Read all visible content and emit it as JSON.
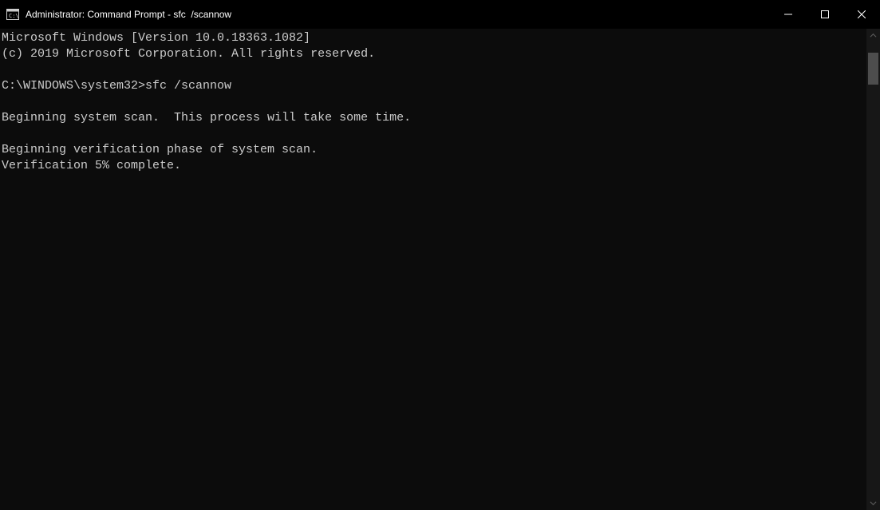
{
  "window": {
    "title": "Administrator: Command Prompt - sfc  /scannow"
  },
  "terminal": {
    "line1": "Microsoft Windows [Version 10.0.18363.1082]",
    "line2": "(c) 2019 Microsoft Corporation. All rights reserved.",
    "blank1": "",
    "prompt": "C:\\WINDOWS\\system32>",
    "command": "sfc /scannow",
    "blank2": "",
    "msg1": "Beginning system scan.  This process will take some time.",
    "blank3": "",
    "msg2": "Beginning verification phase of system scan.",
    "msg3": "Verification 5% complete."
  }
}
